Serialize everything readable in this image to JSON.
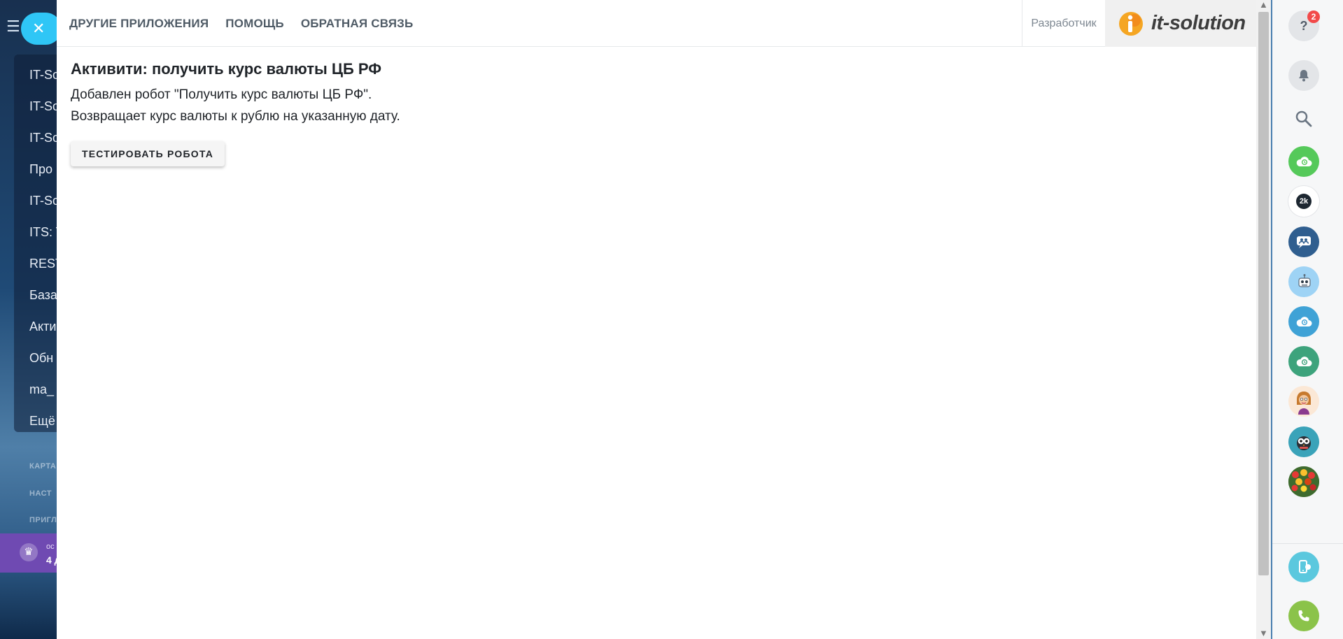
{
  "background": {
    "nav_items": [
      "IT-So",
      "IT-So",
      "IT-So",
      "Про",
      "IT-So",
      "ITS: T",
      "REST",
      "База",
      "Акти",
      "Обн",
      "ma_",
      "Ещё"
    ],
    "section_items": [
      "КАРТА",
      "НАСТ",
      "ПРИГЛ"
    ],
    "promo": {
      "line1": "ос",
      "line2": "4 д"
    }
  },
  "header": {
    "nav": [
      "ДРУГИЕ ПРИЛОЖЕНИЯ",
      "ПОМОЩЬ",
      "ОБРАТНАЯ СВЯЗЬ"
    ],
    "developer_label": "Разработчик",
    "logo_text": "it-solution"
  },
  "content": {
    "title": "Активити: получить курс валюты ЦБ РФ",
    "description_line1": "Добавлен робот \"Получить курс валюты ЦБ РФ\".",
    "description_line2": "Возвращает курс валюты к рублю на указанную дату.",
    "test_button": "ТЕСТИРОВАТЬ РОБОТА"
  },
  "right_bar": {
    "help_badge": "2",
    "icons": [
      "help-icon",
      "bell-icon",
      "search-icon",
      "cloud-clock-icon",
      "avatar-2k",
      "group-chat-icon",
      "robot-avatar",
      "cloud-clock-icon",
      "cloud-clock-icon",
      "avatar-woman",
      "avatar-owl",
      "avatar-flowers",
      "phone-device-icon",
      "phone-call-icon"
    ]
  },
  "colors": {
    "close_button": "#2fc6f6",
    "promo_bg": "#6f4ab2",
    "cloud_green": "#55c95a",
    "cloud_blue": "#3fa2d6",
    "cloud_teal": "#3da37c",
    "group_chat": "#2f5e8f",
    "phone_green": "#8bc34a",
    "phone_device": "#5bc8de"
  }
}
